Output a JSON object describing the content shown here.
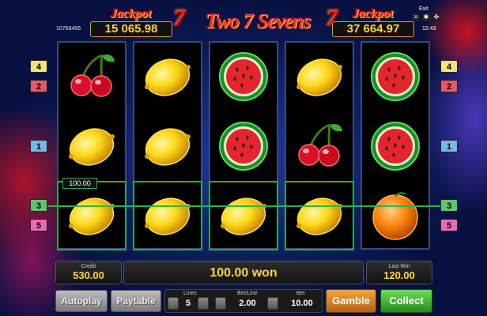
{
  "header": {
    "title": "Two 7 Sevens",
    "left_jackpot_label": "Jackpot",
    "left_jackpot_value": "15 065.98",
    "right_jackpot_label": "Jackpot",
    "right_jackpot_value": "37 664.97",
    "seven_glyph": "7",
    "game_id": "10768466",
    "exit_label": "Exit",
    "clock": "12:43"
  },
  "reels": [
    [
      "cherry",
      "lemon",
      "lemon"
    ],
    [
      "lemon",
      "lemon",
      "lemon"
    ],
    [
      "watermelon",
      "watermelon",
      "lemon"
    ],
    [
      "lemon",
      "cherry",
      "lemon"
    ],
    [
      "watermelon",
      "watermelon",
      "orange"
    ]
  ],
  "win_line": {
    "amount": "100.00",
    "line_number": "3",
    "color": "#31b14d"
  },
  "line_markers": {
    "left": [
      "4",
      "2",
      "1",
      "3",
      "5"
    ],
    "right": [
      "4",
      "2",
      "1",
      "3",
      "5"
    ]
  },
  "bottom": {
    "credit_label": "Credit",
    "credit_value": "530.00",
    "win_message": "100.00 won",
    "last_win_label": "Last Win",
    "last_win_value": "120.00",
    "autoplay_label": "Autoplay",
    "paytable_label": "Paytable",
    "lines_label": "Lines",
    "lines_value": "5",
    "bet_line_label": "Bet/Line",
    "bet_line_value": "2.00",
    "bet_label": "Bet",
    "bet_value": "10.00",
    "gamble_label": "Gamble",
    "collect_label": "Collect"
  }
}
